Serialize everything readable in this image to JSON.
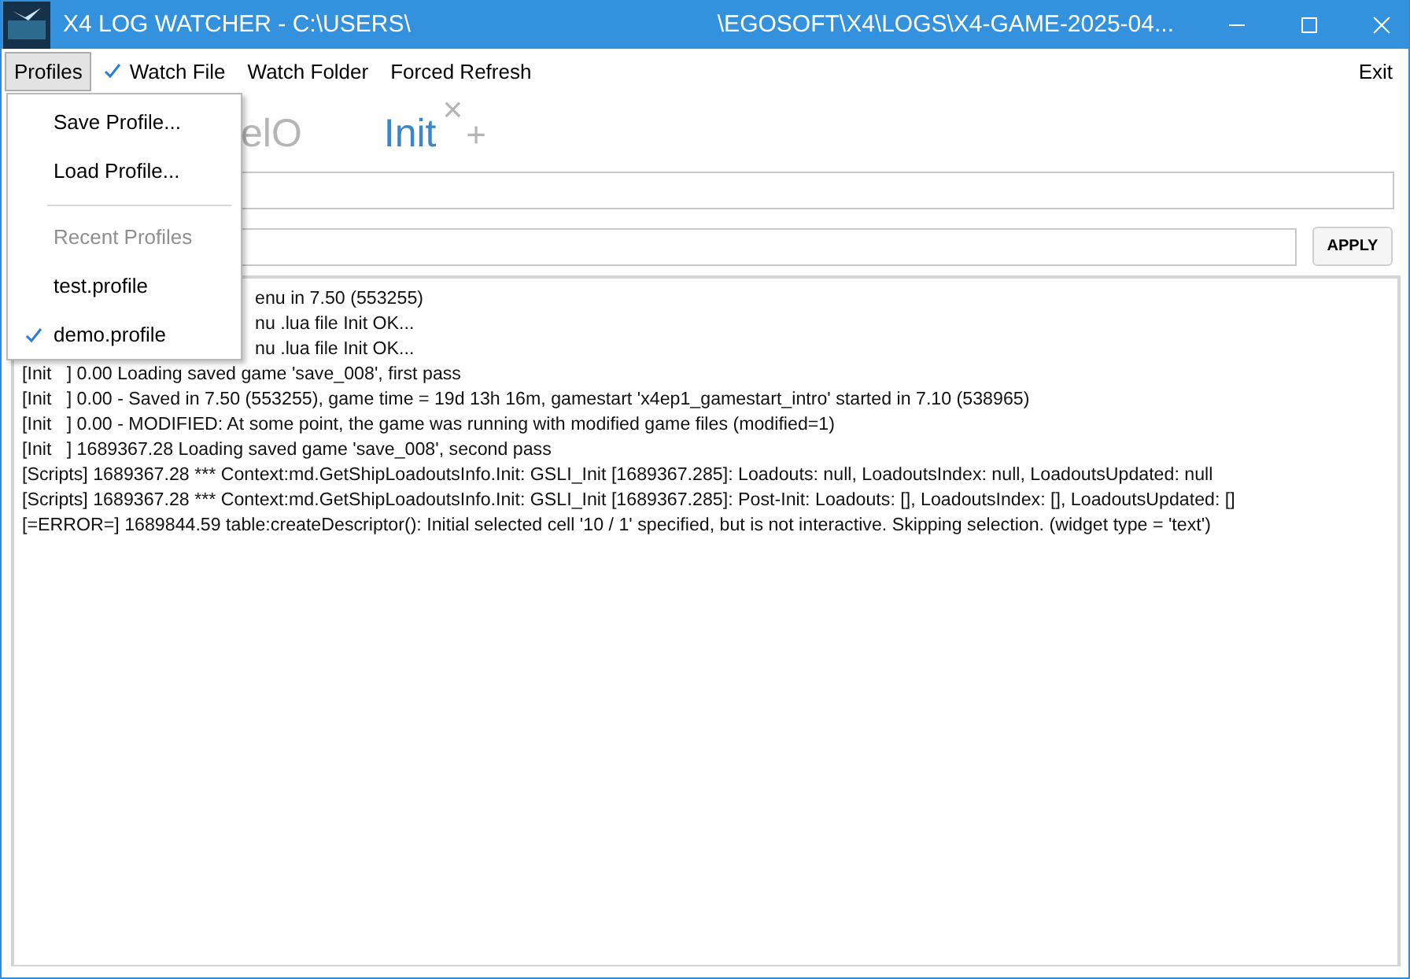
{
  "window": {
    "title": "X4 LOG WATCHER - C:\\USERS\\",
    "title_tail": "\\EGOSOFT\\X4\\LOGS\\X4-GAME-2025-04..."
  },
  "menu_bar": {
    "items": [
      {
        "label": "Profiles",
        "selected": true,
        "checked": false
      },
      {
        "label": "Watch File",
        "selected": false,
        "checked": true
      },
      {
        "label": "Watch Folder",
        "selected": false,
        "checked": false
      },
      {
        "label": "Forced Refresh",
        "selected": false,
        "checked": false
      }
    ],
    "exit": "Exit"
  },
  "profiles_menu": {
    "items": [
      {
        "kind": "action",
        "label": "Save Profile..."
      },
      {
        "kind": "action",
        "label": "Load Profile..."
      },
      {
        "kind": "separator"
      },
      {
        "kind": "header",
        "label": "Recent Profiles"
      },
      {
        "kind": "profile",
        "label": "test.profile",
        "checked": false
      },
      {
        "kind": "profile",
        "label": "demo.profile",
        "checked": true
      }
    ]
  },
  "tabs": [
    {
      "label": "elO",
      "selected": false,
      "covered": true
    },
    {
      "label": "Init",
      "selected": true,
      "covered": false,
      "close": "×"
    }
  ],
  "add_tab": "+",
  "apply_button": "APPLY",
  "log": {
    "lines_under_menu": [
      "enu in 7.50 (553255)",
      "nu .lua file Init OK...",
      "nu .lua file Init OK..."
    ],
    "lines": [
      "[Init   ] 0.00 Loading saved game 'save_008', first pass",
      "[Init   ] 0.00 - Saved in 7.50 (553255), game time = 19d 13h 16m, gamestart 'x4ep1_gamestart_intro' started in 7.10 (538965)",
      "[Init   ] 0.00 - MODIFIED: At some point, the game was running with modified game files (modified=1)",
      "[Init   ] 1689367.28 Loading saved game 'save_008', second pass",
      "[Scripts] 1689367.28 *** Context:md.GetShipLoadoutsInfo.Init: GSLI_Init [1689367.285]: Loadouts: null, LoadoutsIndex: null, LoadoutsUpdated: null",
      "[Scripts] 1689367.28 *** Context:md.GetShipLoadoutsInfo.Init: GSLI_Init [1689367.285]: Post-Init: Loadouts: [], LoadoutsIndex: [], LoadoutsUpdated: []",
      "[=ERROR=] 1689844.59 table:createDescriptor(): Initial selected cell '10 / 1' specified, but is not interactive. Skipping selection. (widget type = 'text')"
    ]
  }
}
